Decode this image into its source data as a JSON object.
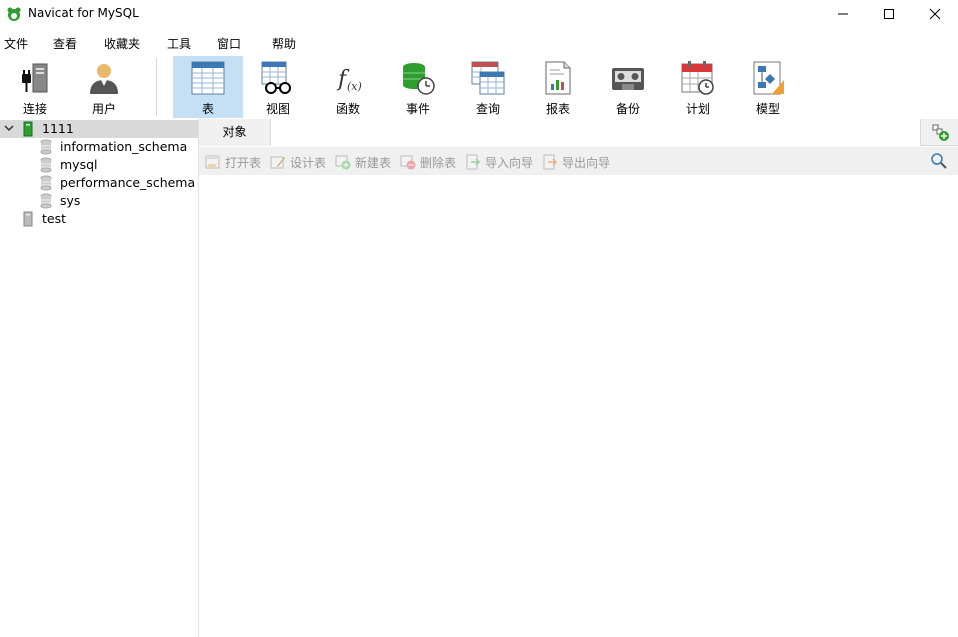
{
  "window": {
    "title": "Navicat for MySQL"
  },
  "menu": [
    "文件",
    "查看",
    "收藏夹",
    "工具",
    "窗口",
    "帮助"
  ],
  "toolbar": {
    "connect": "连接",
    "user": "用户",
    "table": "表",
    "view": "视图",
    "function": "函数",
    "event": "事件",
    "query": "查询",
    "report": "报表",
    "backup": "备份",
    "schedule": "计划",
    "model": "模型"
  },
  "tree": {
    "connections": [
      {
        "name": "1111",
        "expanded": true,
        "databases": [
          "information_schema",
          "mysql",
          "performance_schema",
          "sys"
        ]
      },
      {
        "name": "test",
        "expanded": false
      }
    ]
  },
  "tabs": {
    "objects": "对象"
  },
  "object_toolbar": {
    "open": "打开表",
    "design": "设计表",
    "new": "新建表",
    "delete": "删除表",
    "import": "导入向导",
    "export": "导出向导"
  },
  "colors": {
    "active_tool": "#c5dff5",
    "selected_row": "#d9d9d9",
    "brand_green": "#2e9e2e"
  }
}
